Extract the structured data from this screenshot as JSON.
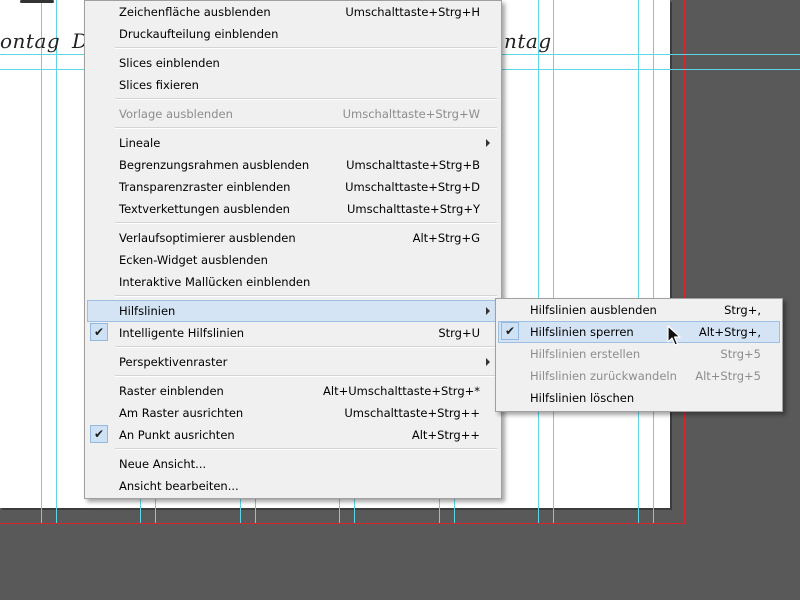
{
  "canvas": {
    "day_labels": [
      "ontag",
      "D",
      "ntag"
    ]
  },
  "main_menu": {
    "items": [
      {
        "label": "Zeichenfläche ausblenden",
        "shortcut": "Umschalttaste+Strg+H"
      },
      {
        "label": "Druckaufteilung einblenden",
        "shortcut": ""
      },
      {
        "label": "Slices einblenden",
        "shortcut": ""
      },
      {
        "label": "Slices fixieren",
        "shortcut": ""
      },
      {
        "label": "Vorlage ausblenden",
        "shortcut": "Umschalttaste+Strg+W"
      },
      {
        "label": "Lineale",
        "shortcut": ""
      },
      {
        "label": "Begrenzungsrahmen ausblenden",
        "shortcut": "Umschalttaste+Strg+B"
      },
      {
        "label": "Transparenzraster einblenden",
        "shortcut": "Umschalttaste+Strg+D"
      },
      {
        "label": "Textverkettungen ausblenden",
        "shortcut": "Umschalttaste+Strg+Y"
      },
      {
        "label": "Verlaufsoptimierer ausblenden",
        "shortcut": "Alt+Strg+G"
      },
      {
        "label": "Ecken-Widget ausblenden",
        "shortcut": ""
      },
      {
        "label": "Interaktive Mallücken einblenden",
        "shortcut": ""
      },
      {
        "label": "Hilfslinien",
        "shortcut": ""
      },
      {
        "label": "Intelligente Hilfslinien",
        "shortcut": "Strg+U"
      },
      {
        "label": "Perspektivenraster",
        "shortcut": ""
      },
      {
        "label": "Raster einblenden",
        "shortcut": "Alt+Umschalttaste+Strg+*"
      },
      {
        "label": "Am Raster ausrichten",
        "shortcut": "Umschalttaste+Strg++"
      },
      {
        "label": "An Punkt ausrichten",
        "shortcut": "Alt+Strg++"
      },
      {
        "label": "Neue Ansicht...",
        "shortcut": ""
      },
      {
        "label": "Ansicht bearbeiten...",
        "shortcut": ""
      }
    ]
  },
  "sub_menu": {
    "items": [
      {
        "label": "Hilfslinien ausblenden",
        "shortcut": "Strg+,"
      },
      {
        "label": "Hilfslinien sperren",
        "shortcut": "Alt+Strg+,"
      },
      {
        "label": "Hilfslinien erstellen",
        "shortcut": "Strg+5"
      },
      {
        "label": "Hilfslinien zurückwandeln",
        "shortcut": "Alt+Strg+5"
      },
      {
        "label": "Hilfslinien löschen",
        "shortcut": ""
      }
    ]
  },
  "icons": {
    "check": "✔",
    "submenu_arrow": "chevron-right-icon",
    "cursor": "pointer-cursor-icon"
  },
  "colors": {
    "pasteboard": "#595959",
    "guide": "#5fd6e6",
    "bleed": "#d9262e",
    "highlight": "#d5e4f4"
  }
}
